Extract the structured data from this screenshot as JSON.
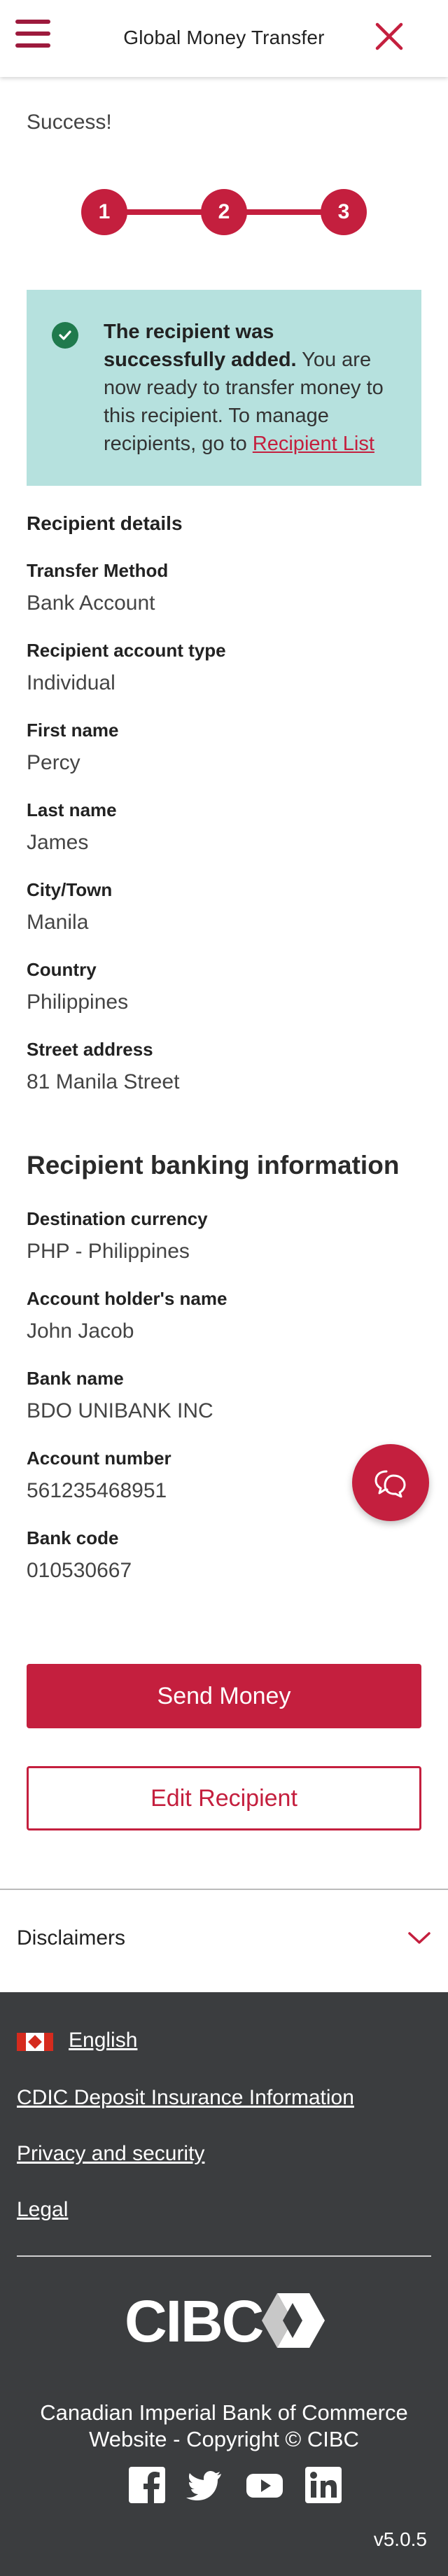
{
  "header": {
    "title": "Global Money Transfer"
  },
  "status": {
    "text": "Success!"
  },
  "stepper": {
    "steps": [
      "1",
      "2",
      "3"
    ]
  },
  "notice": {
    "bold": "The recipient was successfully added.",
    "body": " You are now ready to transfer money to this recipient. To manage recipients, go to ",
    "link": "Recipient List"
  },
  "recipient_details": {
    "heading": "Recipient details",
    "fields": [
      {
        "label": "Transfer Method",
        "value": "Bank Account"
      },
      {
        "label": "Recipient account type",
        "value": "Individual"
      },
      {
        "label": "First name",
        "value": "Percy"
      },
      {
        "label": "Last name",
        "value": "James"
      },
      {
        "label": "City/Town",
        "value": "Manila"
      },
      {
        "label": "Country",
        "value": "Philippines"
      },
      {
        "label": "Street address",
        "value": "81 Manila Street"
      }
    ]
  },
  "banking": {
    "heading": "Recipient banking information",
    "fields": [
      {
        "label": "Destination currency",
        "value": "PHP - Philippines"
      },
      {
        "label": "Account holder's name",
        "value": "John Jacob"
      },
      {
        "label": "Bank name",
        "value": "BDO UNIBANK INC"
      },
      {
        "label": "Account number",
        "value": "561235468951"
      },
      {
        "label": "Bank code",
        "value": "010530667"
      }
    ]
  },
  "actions": {
    "send_money": "Send Money",
    "edit_recipient": "Edit Recipient"
  },
  "disclaimers": {
    "label": "Disclaimers"
  },
  "footer": {
    "language": "English",
    "links": [
      "CDIC Deposit Insurance Information",
      "Privacy and security",
      "Legal"
    ],
    "logo_text": "CIBC",
    "copyright_line1": "Canadian Imperial Bank of Commerce",
    "copyright_line2": "Website - Copyright © CIBC",
    "social_icons": [
      "facebook-icon",
      "twitter-icon",
      "youtube-icon",
      "linkedin-icon"
    ],
    "version": "v5.0.5"
  },
  "colors": {
    "brand": "#c41f3e",
    "notice_bg": "#b6e1de",
    "footer_bg": "#3b3d3f",
    "success": "#1f7a4d"
  }
}
